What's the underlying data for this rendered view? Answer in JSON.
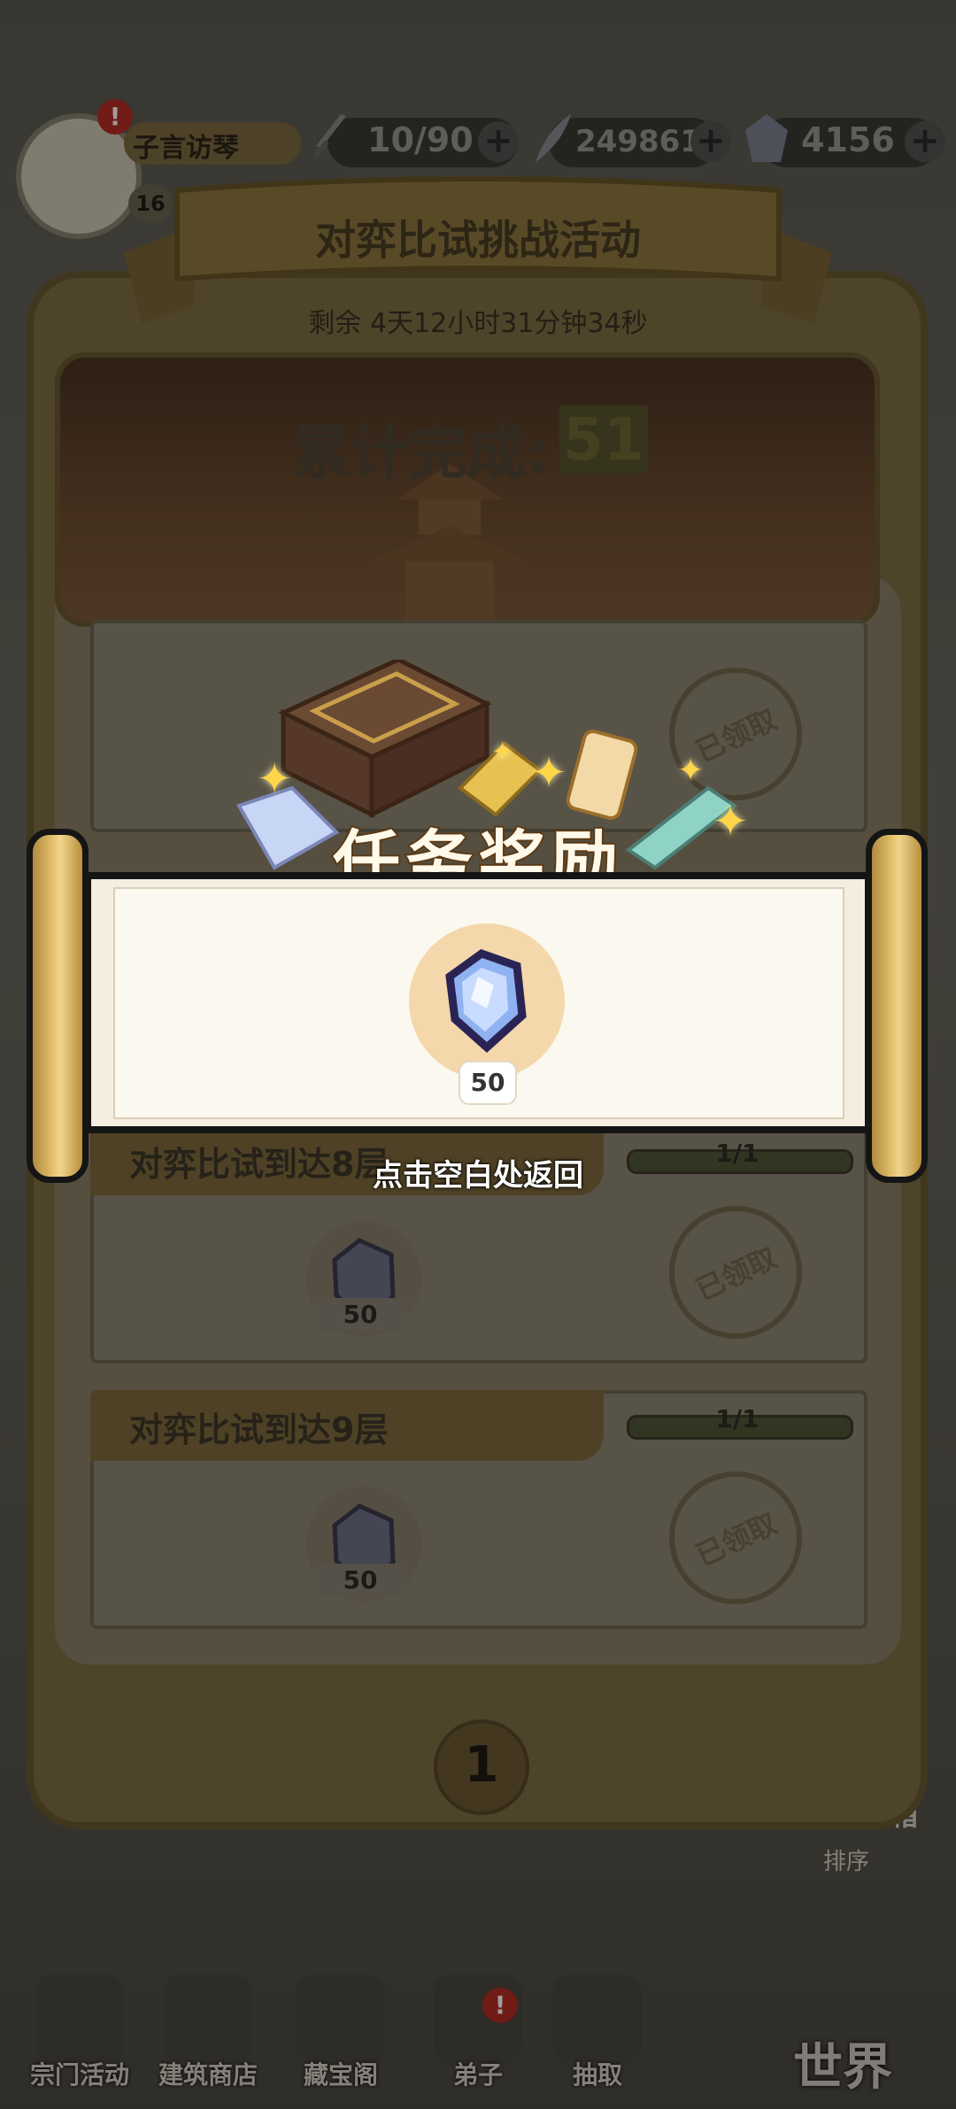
{
  "hud": {
    "player_name": "子言访琴",
    "player_level": "16",
    "alert_mark": "!",
    "stamina": "10/90",
    "coins": "249861",
    "gems": "4156",
    "plus": "+"
  },
  "panel": {
    "title": "对弈比试挑战活动",
    "timer": "剩余 4天12小时31分钟34秒",
    "cumulative_label": "累计完成:",
    "cumulative_value": "51",
    "page_number": "1",
    "tasks": [
      {
        "name": "对弈比试到达8层",
        "progress": "1/1",
        "reward_count": "50",
        "status": "已领取"
      },
      {
        "name": "对弈比试到达9层",
        "progress": "1/1",
        "reward_count": "50",
        "status": "已领取"
      }
    ]
  },
  "popup": {
    "title": "任务奖励",
    "reward_count": "50",
    "dismiss_hint": "点击空白处返回"
  },
  "side": {
    "mailbox": "箱",
    "rank": "排序"
  },
  "nav": {
    "items": [
      "宗门活动",
      "建筑商店",
      "藏宝阁",
      "弟子",
      "抽取"
    ],
    "world": "世界"
  },
  "colors": {
    "gem_primary": "#8fb2f0",
    "popup_title_stroke": "#5b3a16",
    "scroll_roller": "#e3c06c"
  }
}
